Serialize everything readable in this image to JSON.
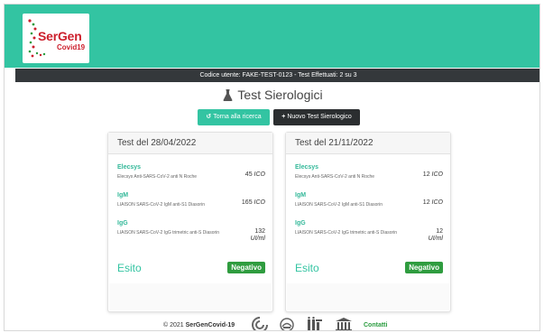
{
  "app": {
    "logo_title": "SerGen",
    "logo_sub": "Covid19"
  },
  "user_bar": {
    "text": "Codice utente: FAKE-TEST-0123 - Test Effettuati: 2 su 3"
  },
  "page": {
    "title": "Test Sierologici"
  },
  "actions": {
    "back_label": "Torna alla ricerca",
    "new_label": "Nuovo Test Sierologico"
  },
  "cards": [
    {
      "header": "Test del 28/04/2022",
      "tests": [
        {
          "name": "Elecsys",
          "desc": "Elecsys Anti-SARS-CoV-2 anti N Roche",
          "value": "45",
          "unit": "ICO"
        },
        {
          "name": "IgM",
          "desc": "LIAISON SARS-CoV-2 IgM anti-S1 Diasorin",
          "value": "165",
          "unit": "ICO"
        },
        {
          "name": "IgG",
          "desc": "LIAISON SARS-CoV-2 IgG trimetric anti-S Diasorin",
          "value": "132",
          "unit": "UI/ml"
        }
      ],
      "esito_label": "Esito",
      "esito_value": "Negativo"
    },
    {
      "header": "Test del 21/11/2022",
      "tests": [
        {
          "name": "Elecsys",
          "desc": "Elecsys Anti-SARS-CoV-2 anti N Roche",
          "value": "12",
          "unit": "ICO"
        },
        {
          "name": "IgM",
          "desc": "LIAISON SARS-CoV-2 IgM anti-S1 Diasorin",
          "value": "12",
          "unit": "ICO"
        },
        {
          "name": "IgG",
          "desc": "LIAISON SARS-CoV-2 IgG trimetric anti-S Diasorin",
          "value": "12",
          "unit": "UI/ml"
        }
      ],
      "esito_label": "Esito",
      "esito_value": "Negativo"
    }
  ],
  "footer": {
    "copyright": "© 2021",
    "brand": "SerGenCovid-19",
    "contact_label": "Contatti",
    "icons": [
      "institution-logo-1-icon",
      "institution-logo-2-icon",
      "institution-logo-3-icon",
      "institution-logo-4-icon"
    ]
  },
  "colors": {
    "brand_teal": "#33c4a2",
    "dark_bar": "#34383b",
    "badge_green": "#2f9c3f",
    "logo_red": "#cc1f2c"
  }
}
